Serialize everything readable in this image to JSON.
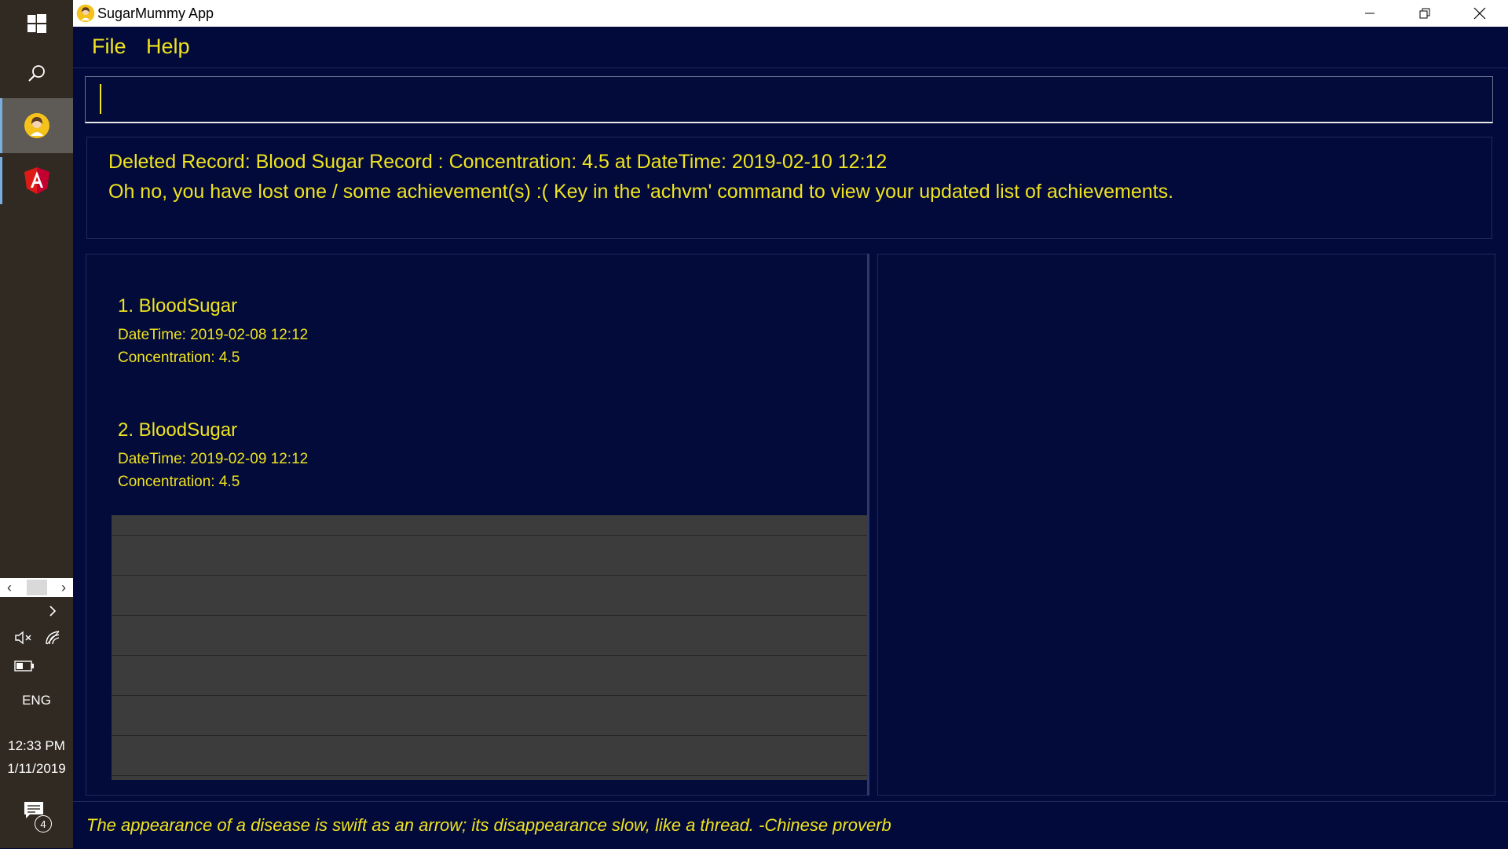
{
  "taskbar": {
    "language": "ENG",
    "time": "12:33 PM",
    "date": "1/11/2019",
    "notification_count": "4",
    "icons": [
      "windows-start-icon",
      "search-icon",
      "sugarmummy-app-icon",
      "angular-app-icon",
      "chevron-left-icon",
      "chevron-right-icon",
      "volume-muted-icon",
      "network-icon",
      "battery-icon",
      "action-center-icon"
    ]
  },
  "window": {
    "title": "SugarMummy App",
    "controls": [
      "minimize-icon",
      "restore-icon",
      "close-icon"
    ]
  },
  "menu": {
    "file": "File",
    "help": "Help"
  },
  "command": {
    "value": "",
    "placeholder": ""
  },
  "result": {
    "line1": "Deleted Record: Blood Sugar Record : Concentration: 4.5 at DateTime: 2019-02-10 12:12",
    "line2": "Oh no, you have lost one / some achievement(s) :( Key in the 'achvm' command to view your updated list of achievements."
  },
  "records": [
    {
      "title": "1.  BloodSugar",
      "datetime": "DateTime: 2019-02-08 12:12",
      "concentration": "Concentration: 4.5"
    },
    {
      "title": "2.  BloodSugar",
      "datetime": "DateTime: 2019-02-09 12:12",
      "concentration": "Concentration: 4.5"
    }
  ],
  "status": {
    "quote": "The appearance of a disease is swift as an arrow; its disappearance slow, like a thread. -Chinese proverb"
  },
  "colors": {
    "background": "#020b3a",
    "text_accent": "#f0e31f",
    "taskbar": "#312a22",
    "empty_list": "#3c3c3c"
  }
}
